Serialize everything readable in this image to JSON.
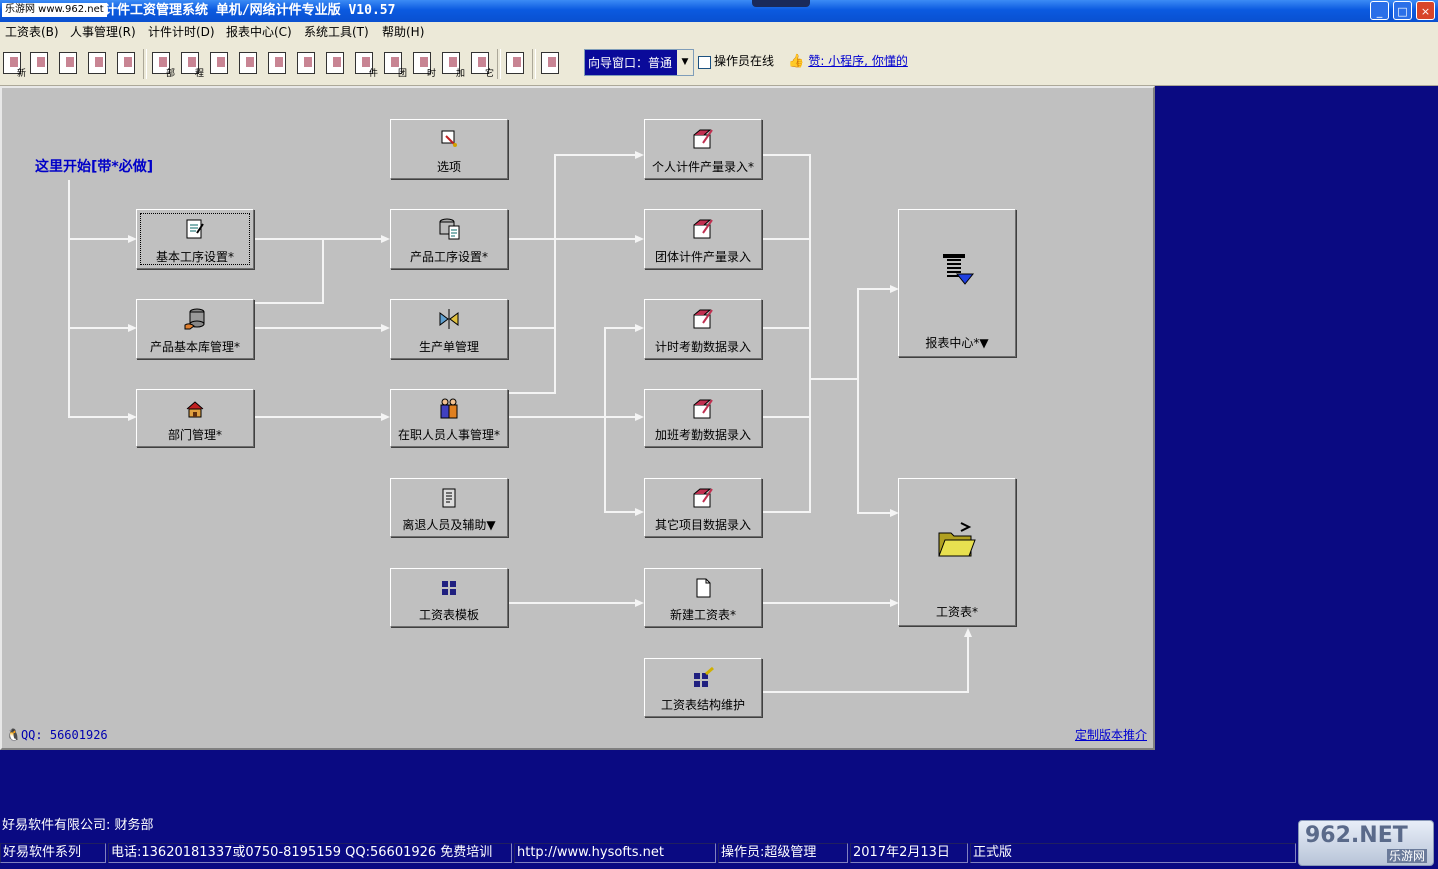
{
  "window": {
    "logo_text": "乐游网 www.962.net",
    "title": "计件工资管理系统  单机/网络计件专业版 V10.57",
    "minimize": "_",
    "maximize": "□",
    "close": "×"
  },
  "menu": [
    "工资表(B)",
    "人事管理(R)",
    "计件计时(D)",
    "报表中心(C)",
    "系统工具(T)",
    "帮助(H)"
  ],
  "toolbar": {
    "buttons": [
      "新",
      "",
      "",
      "",
      "",
      "部",
      "程",
      "",
      "",
      "",
      "",
      "",
      "件",
      "团",
      "时",
      "加",
      "它",
      "",
      ""
    ],
    "guide_label": "向导窗口：普通",
    "operator_online_label": "操作员在线",
    "like_icon": "👍",
    "like_text": "赞: 小程序, 你懂的"
  },
  "flow": {
    "start_text": "这里开始[带*必做]",
    "nodes": {
      "basic_process": "基本工序设置*",
      "product_library": "产品基本库管理*",
      "department": "部门管理*",
      "options": "选项",
      "product_process": "产品工序设置*",
      "production_order": "生产单管理",
      "staff": "在职人员人事管理*",
      "retired_staff": "离退人员及辅助▼",
      "payroll_template": "工资表模板",
      "personal_piece": "个人计件产量录入*",
      "group_piece": "团体计件产量录入",
      "hourly_attendance": "计时考勤数据录入",
      "overtime_attendance": "加班考勤数据录入",
      "other_items": "其它项目数据录入",
      "new_payroll": "新建工资表*",
      "payroll_structure": "工资表结构维护",
      "report_center": "报表中心*▼",
      "payroll": "工资表*"
    },
    "qq_text": "QQ: 56601926",
    "custom_version_link": "定制版本推介"
  },
  "footer": {
    "company": "好易软件有限公司: 财务部",
    "status": [
      "好易软件系列",
      "电话:13620181337或0750-8195159 QQ:56601926 免费培训",
      "http://www.hysofts.net",
      "操作员:超级管理",
      "2017年2月13日",
      "正式版"
    ],
    "watermark_big": "962.NET",
    "watermark_small": "乐游网"
  },
  "colors": {
    "desktop": "#0a0a82",
    "panel": "#c0c0c0",
    "title_blue": "#0b5ae0",
    "link_blue": "#0000d0"
  }
}
